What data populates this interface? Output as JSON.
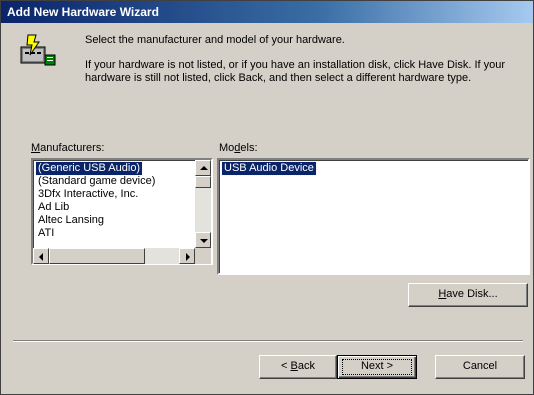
{
  "window": {
    "title": "Add New Hardware Wizard"
  },
  "header": {
    "icon": "hardware-wizard-icon",
    "heading": "Select the manufacturer and model of your hardware.",
    "description": "If your hardware is not listed, or if you have an installation disk, click Have Disk. If your hardware is still not listed, click Back, and then select a different hardware type."
  },
  "manufacturers": {
    "label_mnemonic": "M",
    "label_rest": "anufacturers:",
    "items": [
      "(Generic USB Audio)",
      "(Standard game device)",
      "3Dfx Interactive, Inc.",
      "Ad Lib",
      "Altec Lansing",
      "ATI"
    ],
    "selected_index": 0
  },
  "models": {
    "label_before": "Mo",
    "label_mnemonic": "d",
    "label_after": "els:",
    "items": [
      "USB Audio Device"
    ],
    "selected_index": 0
  },
  "buttons": {
    "have_disk": {
      "mnemonic": "H",
      "rest": "ave Disk..."
    },
    "back": {
      "prefix": "< ",
      "mnemonic": "B",
      "rest": "ack"
    },
    "next": {
      "label": "Next >"
    },
    "cancel": {
      "label": "Cancel"
    }
  },
  "colors": {
    "face": "#d4d0c8",
    "titlebar_start": "#0a246a",
    "titlebar_end": "#a6caf0",
    "selection": "#0a246a"
  }
}
